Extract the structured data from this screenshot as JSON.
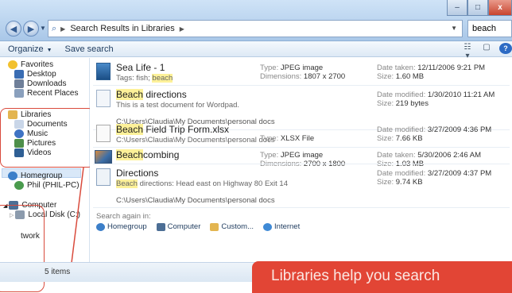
{
  "window": {
    "breadcrumb": "Search Results in Libraries",
    "search_value": "beach",
    "minimize": "–",
    "maximize": "□",
    "close": "x"
  },
  "commandbar": {
    "organize": "Organize",
    "save_search": "Save search"
  },
  "nav": {
    "favorites": "Favorites",
    "desktop": "Desktop",
    "downloads": "Downloads",
    "recent": "Recent Places",
    "libraries": "Libraries",
    "documents": "Documents",
    "music": "Music",
    "pictures": "Pictures",
    "videos": "Videos",
    "homegroup": "Homegroup",
    "phil": "Phil (PHIL-PC)",
    "computer": "Computer",
    "localdisk": "Local Disk (C:)",
    "network": "twork"
  },
  "results": [
    {
      "name": "Sea Life - 1",
      "sub_prefix": "Tags: fish; ",
      "sub_hl": "beach",
      "mid1_k": "Type: ",
      "mid1_v": "JPEG image",
      "mid2_k": "Dimensions: ",
      "mid2_v": "1807 x 2700",
      "r1_k": "Date taken: ",
      "r1_v": "12/11/2006 9:21 PM",
      "r2_k": "Size: ",
      "r2_v": "1.60 MB"
    },
    {
      "name_hl": "Beach",
      "name_rest": " directions",
      "sub": "This is a test document for Wordpad.",
      "r1_k": "Date modified: ",
      "r1_v": "1/30/2010 11:21 AM",
      "r2_k": "Size: ",
      "r2_v": "219 bytes",
      "path": "C:\\Users\\Claudia\\My Documents\\personal docs"
    },
    {
      "name_hl": "Beach",
      "name_rest": " Field Trip Form.xlsx",
      "sub": "C:\\Users\\Claudia\\My Documents\\personal docs",
      "mid2_k": "Type: ",
      "mid2_v": "XLSX File",
      "r1_k": "Date modified: ",
      "r1_v": "3/27/2009 4:36 PM",
      "r2_k": "Size: ",
      "r2_v": "7.66 KB"
    },
    {
      "name_hl": "Beach",
      "name_rest": "combing",
      "mid1_k": "Type: ",
      "mid1_v": "JPEG image",
      "mid2_k": "Dimensions: ",
      "mid2_v": "2700 x 1800",
      "r1_k": "Date taken: ",
      "r1_v": "5/30/2006 2:46 AM",
      "r2_k": "Size: ",
      "r2_v": "1.03 MB"
    },
    {
      "name": "Directions",
      "sub_hl": "Beach",
      "sub_rest": " directions: Head east on Highway 80 Exit 14",
      "r1_k": "Date modified: ",
      "r1_v": "3/27/2009 4:37 PM",
      "r2_k": "Size: ",
      "r2_v": "9.74 KB",
      "path": "C:\\Users\\Claudia\\My Documents\\personal docs"
    }
  ],
  "search_again": {
    "label": "Search again in:",
    "homegroup": "Homegroup",
    "computer": "Computer",
    "custom": "Custom...",
    "internet": "Internet"
  },
  "status": {
    "count": "5 items"
  },
  "callout": {
    "text": "Libraries help you search"
  },
  "colors": {
    "highlight": "#fdf199",
    "callout": "#e24535",
    "frame": "#d94a3c"
  }
}
